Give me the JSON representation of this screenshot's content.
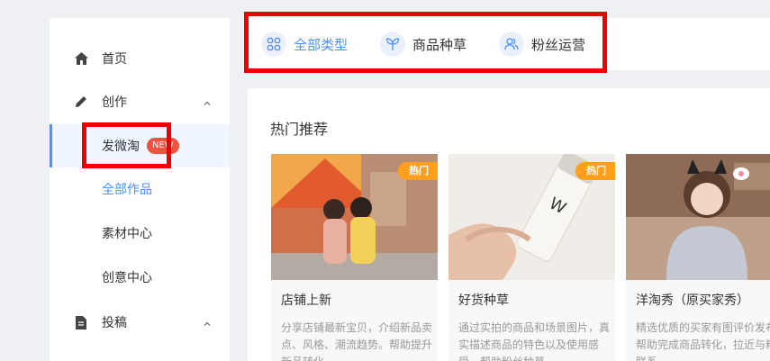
{
  "sidebar": {
    "items": [
      {
        "label": "首页",
        "icon": "home-icon"
      },
      {
        "label": "创作",
        "icon": "pencil-icon",
        "expanded": true
      },
      {
        "label": "投稿",
        "icon": "document-icon",
        "expanded": true
      }
    ],
    "sub_items": [
      {
        "label": "发微淘",
        "badge": "NEW",
        "active": true
      },
      {
        "label": "全部作品"
      },
      {
        "label": "素材中心"
      },
      {
        "label": "创意中心"
      }
    ]
  },
  "tabs": [
    {
      "label": "全部类型",
      "icon": "grid-icon",
      "active": true
    },
    {
      "label": "商品种草",
      "icon": "sprout-icon"
    },
    {
      "label": "粉丝运营",
      "icon": "users-icon"
    }
  ],
  "main": {
    "section_title": "热门推荐",
    "cards": [
      {
        "title": "店铺上新",
        "desc": "分享店铺最新宝贝，介绍新品卖点、风格、潮流趋势。帮助提升新品转化",
        "hot": "热门"
      },
      {
        "title": "好货种草",
        "desc": "通过实拍的商品和场景图片，真实描述商品的特色以及使用感受，帮助粉丝种草",
        "hot": "热门"
      },
      {
        "title": "洋淘秀（原买家秀）",
        "desc": "精选优质的买家有图评价发布，帮助完成商品转化，拉近与粉丝联系",
        "hot": ""
      }
    ]
  },
  "colors": {
    "accent": "#4d90fe",
    "badge_red": "#f1523f",
    "hot_orange": "#ff9f1c",
    "highlight": "#ee0000"
  }
}
